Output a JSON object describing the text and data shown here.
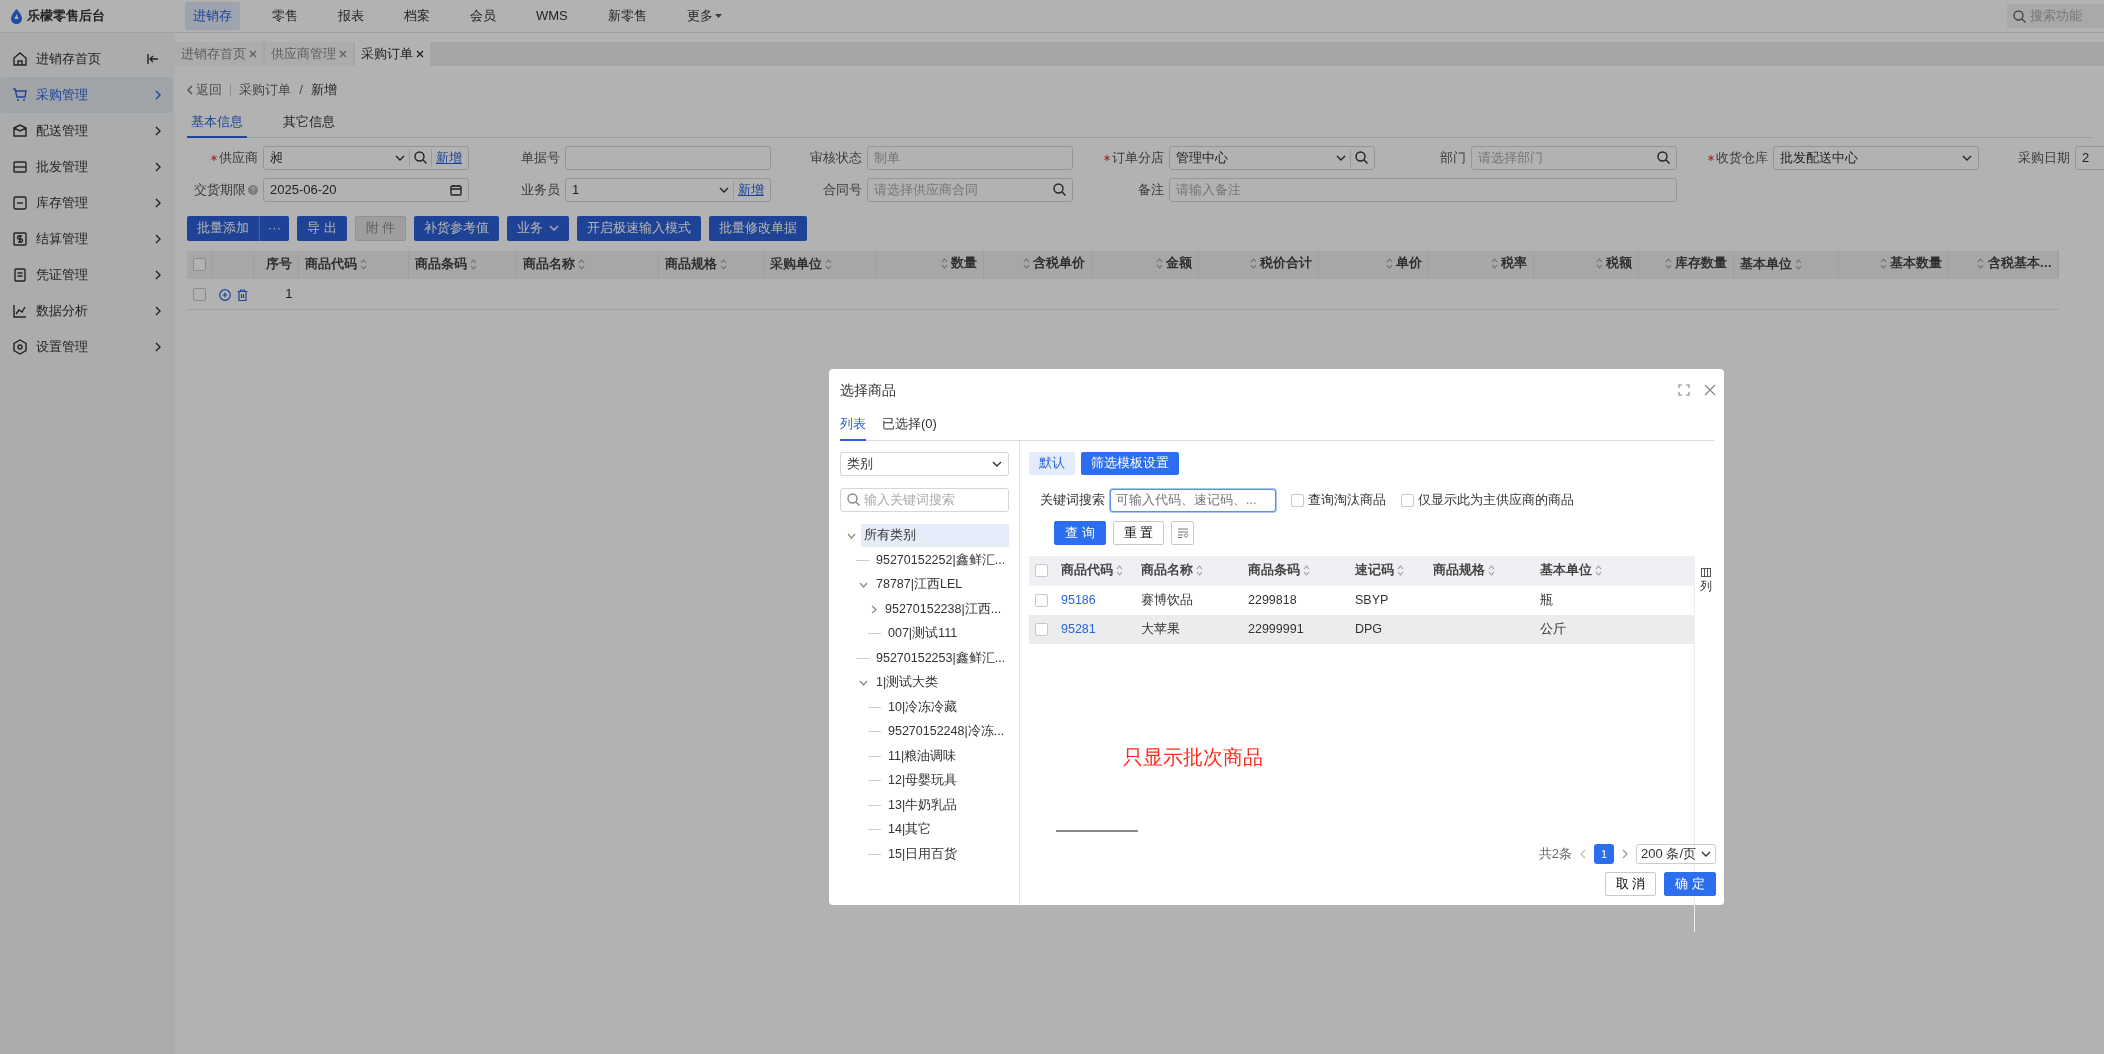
{
  "app": {
    "title": "乐檬零售后台"
  },
  "top_nav": [
    {
      "label": "进销存",
      "selected": true,
      "dropdown": false
    },
    {
      "label": "零售",
      "selected": false,
      "dropdown": false
    },
    {
      "label": "报表",
      "selected": false,
      "dropdown": false
    },
    {
      "label": "档案",
      "selected": false,
      "dropdown": false
    },
    {
      "label": "会员",
      "selected": false,
      "dropdown": false
    },
    {
      "label": "WMS",
      "selected": false,
      "dropdown": false
    },
    {
      "label": "新零售",
      "selected": false,
      "dropdown": false
    },
    {
      "label": "更多",
      "selected": false,
      "dropdown": true
    }
  ],
  "search": {
    "placeholder": "搜索功能"
  },
  "sidebar": {
    "items": [
      {
        "label": "进销存首页",
        "selected": false,
        "submenu": false
      },
      {
        "label": "采购管理",
        "selected": true,
        "submenu": true
      },
      {
        "label": "配送管理",
        "selected": false,
        "submenu": true
      },
      {
        "label": "批发管理",
        "selected": false,
        "submenu": true
      },
      {
        "label": "库存管理",
        "selected": false,
        "submenu": true
      },
      {
        "label": "结算管理",
        "selected": false,
        "submenu": true
      },
      {
        "label": "凭证管理",
        "selected": false,
        "submenu": true
      },
      {
        "label": "数据分析",
        "selected": false,
        "submenu": true
      },
      {
        "label": "设置管理",
        "selected": false,
        "submenu": true
      }
    ]
  },
  "page_tabs": [
    {
      "label": "进销存首页",
      "selected": false
    },
    {
      "label": "供应商管理",
      "selected": false
    },
    {
      "label": "采购订单",
      "selected": true
    }
  ],
  "breadcrumb": {
    "back": "返回",
    "path": [
      "采购订单",
      "新增"
    ],
    "separator": "/"
  },
  "form_tabs": [
    {
      "label": "基本信息",
      "selected": true
    },
    {
      "label": "其它信息",
      "selected": false
    }
  ],
  "form_rows": [
    [
      {
        "label": "供应商",
        "required": true,
        "help": false,
        "kind": "select",
        "value": "昶",
        "search_button": true,
        "action": "新增",
        "wide": false
      },
      {
        "label": "单据号",
        "required": false,
        "help": false,
        "kind": "text",
        "wide": false,
        "search_button": false
      },
      {
        "label": "审核状态",
        "required": false,
        "help": false,
        "kind": "text",
        "placeholder": "制单",
        "wide": false,
        "search_button": false
      },
      {
        "label": "订单分店",
        "required": true,
        "help": false,
        "kind": "select",
        "value": "管理中心",
        "search_button": true,
        "wide": false
      },
      {
        "label": "部门",
        "required": false,
        "help": false,
        "kind": "search",
        "placeholder": "请选择部门",
        "wide": false,
        "search_button": false
      },
      {
        "label": "收货仓库",
        "required": true,
        "help": false,
        "kind": "select",
        "value": "批发配送中心",
        "wide": false,
        "search_button": false
      },
      {
        "label": "采购日期",
        "required": false,
        "help": false,
        "kind": "text",
        "value": "2",
        "wide": false,
        "search_button": false
      }
    ],
    [
      {
        "label": "交货期限",
        "required": false,
        "help": true,
        "kind": "date",
        "value": "2025-06-20",
        "wide": false,
        "search_button": false
      },
      {
        "label": "业务员",
        "required": false,
        "help": false,
        "kind": "select",
        "value": "1",
        "action": "新增",
        "wide": false,
        "search_button": false
      },
      {
        "label": "合同号",
        "required": false,
        "help": false,
        "kind": "search",
        "placeholder": "请选择供应商合同",
        "wide": false,
        "search_button": false
      },
      {
        "label": "备注",
        "required": false,
        "help": false,
        "kind": "text",
        "placeholder": "请输入备注",
        "wide": true,
        "search_button": false
      }
    ]
  ],
  "toolbar": [
    {
      "label": "批量添加",
      "kind": "split",
      "disabled": false,
      "more": "···"
    },
    {
      "label": "导 出",
      "kind": "primary",
      "disabled": false
    },
    {
      "label": "附 件",
      "kind": "primary",
      "disabled": true
    },
    {
      "label": "补货参考值",
      "kind": "primary",
      "disabled": false
    },
    {
      "label": "业务",
      "kind": "dropdown",
      "disabled": false
    },
    {
      "label": "开启极速输入模式",
      "kind": "primary",
      "disabled": false
    },
    {
      "label": "批量修改单据",
      "kind": "primary",
      "disabled": false
    }
  ],
  "order_table": {
    "all_checked": false,
    "columns": [
      {
        "label": "序号",
        "sortable": false,
        "kind": "number"
      },
      {
        "label": "商品代码",
        "sortable": true,
        "kind": "text"
      },
      {
        "label": "商品条码",
        "sortable": true,
        "kind": "text"
      },
      {
        "label": "商品名称",
        "sortable": true,
        "kind": "text"
      },
      {
        "label": "商品规格",
        "sortable": true,
        "kind": "text"
      },
      {
        "label": "采购单位",
        "sortable": true,
        "kind": "text"
      },
      {
        "label": "数量",
        "sortable": true,
        "kind": "number"
      },
      {
        "label": "含税单价",
        "sortable": true,
        "kind": "number"
      },
      {
        "label": "金额",
        "sortable": true,
        "kind": "number"
      },
      {
        "label": "税价合计",
        "sortable": true,
        "kind": "number"
      },
      {
        "label": "单价",
        "sortable": true,
        "kind": "number"
      },
      {
        "label": "税率",
        "sortable": true,
        "kind": "number"
      },
      {
        "label": "税额",
        "sortable": true,
        "kind": "number"
      },
      {
        "label": "库存数量",
        "sortable": true,
        "kind": "number"
      },
      {
        "label": "基本单位",
        "sortable": true,
        "kind": "text"
      },
      {
        "label": "基本数量",
        "sortable": true,
        "kind": "number"
      },
      {
        "label": "含税基本…",
        "sortable": true,
        "kind": "number"
      }
    ],
    "rows": [
      {
        "index": "1",
        "checked": false
      }
    ]
  },
  "dialog": {
    "title": "选择商品",
    "tabs": [
      {
        "label": "列表",
        "selected": true
      },
      {
        "label": "已选择(0)",
        "selected": false
      }
    ],
    "category_select": {
      "value": "类别"
    },
    "tree_search": {
      "placeholder": "输入关键词搜索"
    },
    "tree": [
      {
        "label": "所有类别",
        "selected": true,
        "expanded": true,
        "children": [
          {
            "label": "95270152252|鑫鲜汇...",
            "selected": false
          },
          {
            "label": "78787|江西LEL",
            "selected": false,
            "expanded": true,
            "children": [
              {
                "label": "95270152238|江西...",
                "selected": false,
                "expanded": false
              },
              {
                "label": "007|测试111",
                "selected": false
              }
            ]
          },
          {
            "label": "95270152253|鑫鲜汇...",
            "selected": false
          },
          {
            "label": "1|测试大类",
            "selected": false,
            "expanded": true,
            "children": [
              {
                "label": "10|冷冻冷藏",
                "selected": false
              },
              {
                "label": "95270152248|冷冻...",
                "selected": false
              },
              {
                "label": "11|粮油调味",
                "selected": false
              },
              {
                "label": "12|母婴玩具",
                "selected": false
              },
              {
                "label": "13|牛奶乳品",
                "selected": false
              },
              {
                "label": "14|其它",
                "selected": false
              },
              {
                "label": "15|日用百货",
                "selected": false
              }
            ]
          }
        ]
      }
    ],
    "templates": [
      {
        "label": "默认",
        "kind": "light"
      },
      {
        "label": "筛选模板设置",
        "kind": "primary"
      }
    ],
    "keyword": {
      "label": "关键词搜索",
      "placeholder": "可输入代码、速记码、...",
      "focused": true
    },
    "options": [
      {
        "label": "查询淘汰商品",
        "checked": false
      },
      {
        "label": "仅显示此为主供应商的商品",
        "checked": false
      }
    ],
    "actions": [
      {
        "label": "查 询",
        "kind": "primary"
      },
      {
        "label": "重 置",
        "kind": "default"
      }
    ],
    "columns_button": "列",
    "product_table": {
      "all_checked": false,
      "columns": [
        "商品代码",
        "商品名称",
        "商品条码",
        "速记码",
        "商品规格",
        "基本单位"
      ],
      "rows": [
        {
          "checked": false,
          "highlighted": false,
          "cells": [
            "95186",
            "赛博饮品",
            "2299818",
            "SBYP",
            "",
            "瓶"
          ]
        },
        {
          "checked": false,
          "highlighted": true,
          "cells": [
            "95281",
            "大苹果",
            "22999991",
            "DPG",
            "",
            "公斤"
          ]
        }
      ]
    },
    "annotation": {
      "text": "只显示批次商品",
      "color": "#ff2a1a"
    },
    "pagination": {
      "total": "共2条",
      "pages": [
        {
          "label": "1",
          "selected": true
        }
      ],
      "page_size": "200 条/页"
    },
    "footer": [
      {
        "label": "取 消",
        "kind": "default"
      },
      {
        "label": "确 定",
        "kind": "primary"
      }
    ]
  }
}
